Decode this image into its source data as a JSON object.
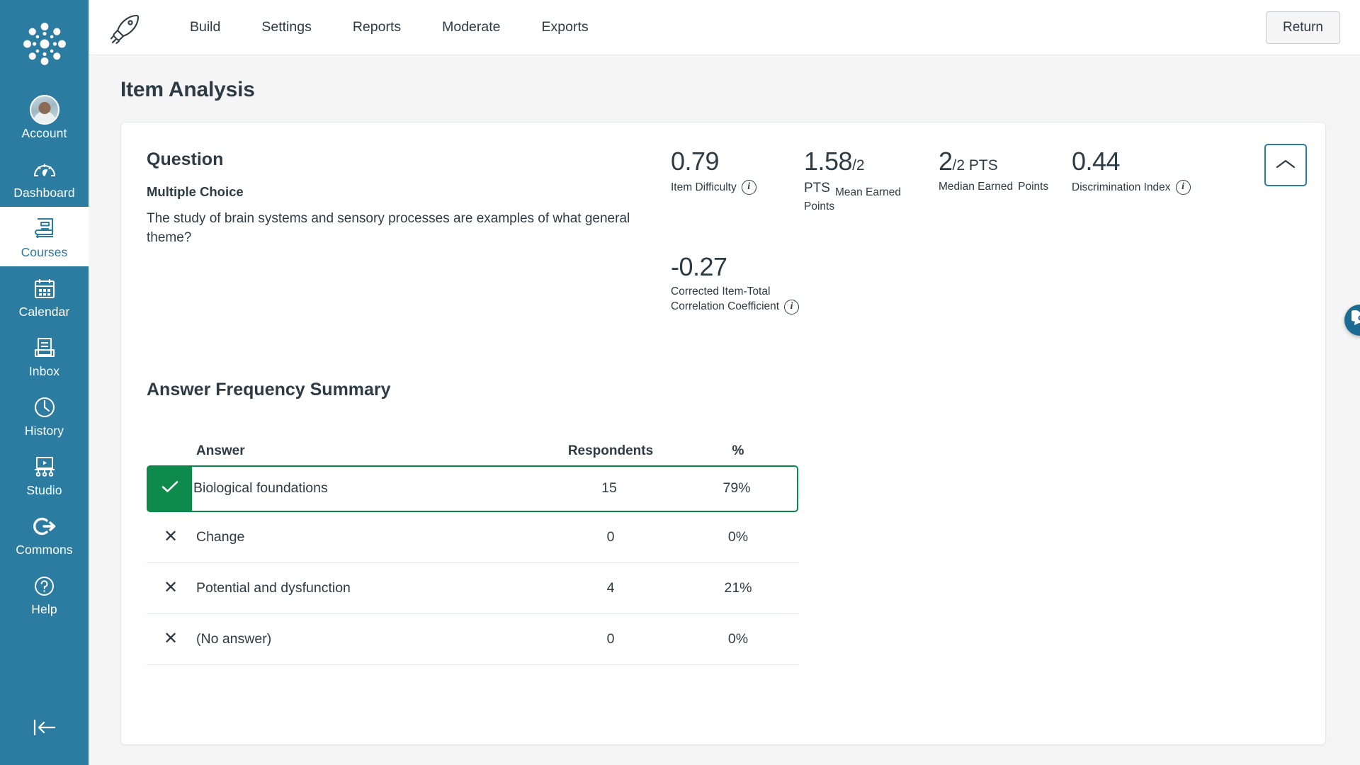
{
  "sidebar": {
    "logo_icon": "canvas-logo-icon",
    "items": [
      {
        "label": "Account",
        "icon": "avatar-icon",
        "active": false
      },
      {
        "label": "Dashboard",
        "icon": "gauge-icon",
        "active": false
      },
      {
        "label": "Courses",
        "icon": "book-icon",
        "active": true
      },
      {
        "label": "Calendar",
        "icon": "calendar-icon",
        "active": false
      },
      {
        "label": "Inbox",
        "icon": "inbox-icon",
        "active": false
      },
      {
        "label": "History",
        "icon": "clock-icon",
        "active": false
      },
      {
        "label": "Studio",
        "icon": "studio-icon",
        "active": false
      },
      {
        "label": "Commons",
        "icon": "commons-icon",
        "active": false
      },
      {
        "label": "Help",
        "icon": "question-circle-icon",
        "active": false
      }
    ],
    "collapse_icon": "collapse-left-arrow-icon"
  },
  "topbar": {
    "app_icon": "rocket-icon",
    "nav": [
      {
        "label": "Build"
      },
      {
        "label": "Settings"
      },
      {
        "label": "Reports"
      },
      {
        "label": "Moderate"
      },
      {
        "label": "Exports"
      }
    ],
    "return_label": "Return"
  },
  "page": {
    "title": "Item Analysis"
  },
  "question": {
    "heading": "Question",
    "type": "Multiple Choice",
    "text": "The study of brain systems and sensory processes are examples of what general theme?"
  },
  "stats": [
    {
      "value": "0.79",
      "value_suffix": "",
      "value_units": "",
      "caption_lines": [
        "Item Difficulty"
      ],
      "info_icon": "info-icon"
    },
    {
      "value": "1.58",
      "value_suffix": "/2",
      "value_units": "",
      "caption_lines": [
        "PTS",
        "Mean Earned",
        "Points"
      ],
      "info_icon": ""
    },
    {
      "value": "2",
      "value_suffix": "/2",
      "value_units": " PTS",
      "caption_lines": [
        "Median Earned",
        "Points"
      ],
      "info_icon": ""
    },
    {
      "value": "0.44",
      "value_suffix": "",
      "value_units": "",
      "caption_lines": [
        "Discrimination Index"
      ],
      "info_icon": "info-icon"
    },
    {
      "value": "-0.27",
      "value_suffix": "",
      "value_units": "",
      "caption_lines": [
        "Corrected Item-Total",
        "Correlation Coefficient"
      ],
      "info_icon": "info-icon"
    }
  ],
  "collapse_button": {
    "icon": "chevron-up-icon",
    "accent": "#2b7ca0"
  },
  "answer_summary": {
    "title": "Answer Frequency Summary",
    "columns": {
      "answer": "Answer",
      "respondents": "Respondents",
      "percent": "%"
    },
    "rows": [
      {
        "mark": "check-icon",
        "correct": true,
        "answer": "Biological foundations",
        "respondents": "15",
        "percent": "79%"
      },
      {
        "mark": "x-icon",
        "correct": false,
        "answer": "Change",
        "respondents": "0",
        "percent": "0%"
      },
      {
        "mark": "x-icon",
        "correct": false,
        "answer": "Potential and dysfunction",
        "respondents": "4",
        "percent": "21%"
      },
      {
        "mark": "x-icon",
        "correct": false,
        "answer": "(No answer)",
        "respondents": "0",
        "percent": "0%"
      }
    ]
  },
  "fab": {
    "icon": "chat-bubble-icon",
    "color": "#1b6b93"
  },
  "colors": {
    "sidebar_bg": "#2c7ba0",
    "accent": "#2b7ca0",
    "correct_green": "#0e8a4c",
    "page_bg": "#f5f5f5",
    "text": "#2d3b45"
  }
}
